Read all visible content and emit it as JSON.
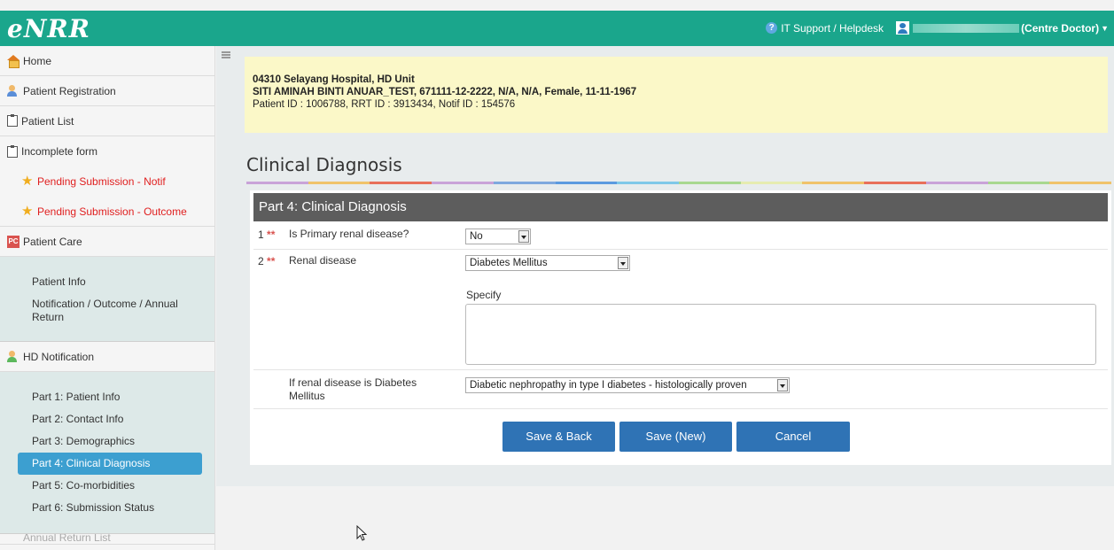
{
  "app": {
    "logo": "eNRR",
    "helpdesk_label": "IT Support / Helpdesk",
    "user_role": "(Centre Doctor)"
  },
  "sidebar": {
    "home": "Home",
    "patient_registration": "Patient Registration",
    "patient_list": "Patient List",
    "incomplete_form": "Incomplete form",
    "pending_notif": "Pending Submission - Notif",
    "pending_outcome": "Pending Submission - Outcome",
    "patient_care": "Patient Care",
    "patient_care_items": [
      "Patient Info",
      "Notification / Outcome / Annual Return"
    ],
    "hd_notification": "HD Notification",
    "hd_items": [
      "Part 1: Patient Info",
      "Part 2: Contact Info",
      "Part 3: Demographics",
      "Part 4: Clinical Diagnosis",
      "Part 5: Co-morbidities",
      "Part 6: Submission Status"
    ],
    "active_item": "Part 4: Clinical Diagnosis",
    "cut_off_item": "Annual Return List"
  },
  "patient": {
    "centre": "04310 Selayang Hospital, HD Unit",
    "details": "SITI AMINAH BINTI ANUAR_TEST, 671111-12-2222, N/A, N/A, Female, 11-11-1967",
    "ids": "Patient ID : 1006788, RRT ID : 3913434, Notif ID : 154576"
  },
  "page": {
    "title": "Clinical Diagnosis",
    "section_title": "Part 4: Clinical Diagnosis"
  },
  "form": {
    "q1": {
      "num": "1",
      "required": "**",
      "label": "Is Primary renal disease?",
      "value": "No"
    },
    "q2": {
      "num": "2",
      "required": "**",
      "label": "Renal disease",
      "value": "Diabetes Mellitus",
      "specify_label": "Specify",
      "specify_value": ""
    },
    "q3": {
      "label": "If renal disease is Diabetes Mellitus",
      "value": "Diabetic nephropathy in type I diabetes - histologically proven"
    }
  },
  "buttons": {
    "save_back": "Save & Back",
    "save_new": "Save (New)",
    "cancel": "Cancel"
  },
  "colors": {
    "topbar": "#1aa68c",
    "active_nav": "#3c9fd0",
    "button": "#2f73b5",
    "required": "#d9534f"
  }
}
